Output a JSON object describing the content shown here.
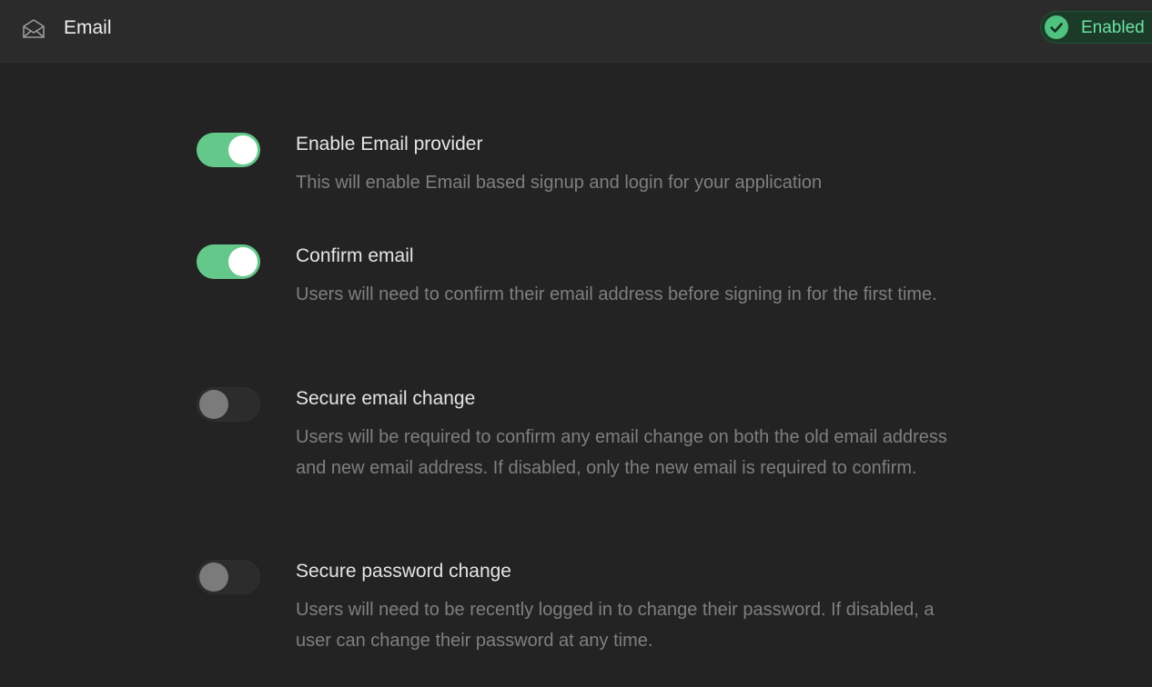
{
  "header": {
    "icon": "envelope-open-icon",
    "title": "Email",
    "status": {
      "icon": "check-icon",
      "label": "Enabled",
      "color": "#4fc27f"
    }
  },
  "settings": [
    {
      "title": "Enable Email provider",
      "description": "This will enable Email based signup and login for your application",
      "enabled": true
    },
    {
      "title": "Confirm email",
      "description": "Users will need to confirm their email address before signing in for the first time.",
      "enabled": true
    },
    {
      "title": "Secure email change",
      "description": "Users will be required to confirm any email change on both the old email address and new email address. If disabled, only the new email is required to confirm.",
      "enabled": false
    },
    {
      "title": "Secure password change",
      "description": "Users will need to be recently logged in to change their password. If disabled, a user can change their password at any time.",
      "enabled": false
    }
  ],
  "colors": {
    "toggle_on": "#65c88b",
    "toggle_off": "#2c2c2c"
  }
}
